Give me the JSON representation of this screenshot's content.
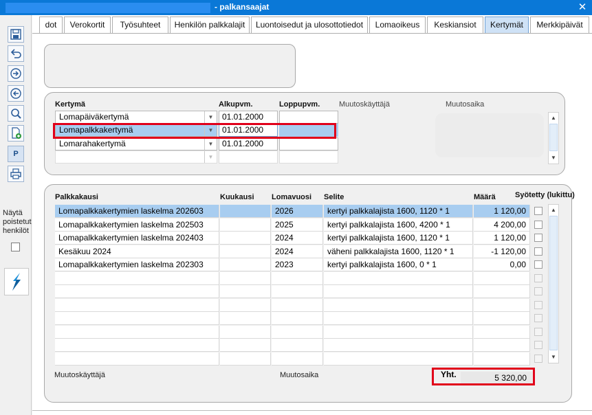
{
  "window": {
    "title": "- palkansaajat",
    "close_glyph": "✕"
  },
  "tabs": [
    {
      "label": "dot"
    },
    {
      "label": "Verokortit"
    },
    {
      "label": "Työsuhteet"
    },
    {
      "label": "Henkilön palkkalajit"
    },
    {
      "label": "Luontoisedut ja ulosottotiedot"
    },
    {
      "label": "Lomaoikeus"
    },
    {
      "label": "Keskiansiot"
    },
    {
      "label": "Kertymät"
    },
    {
      "label": "Merkkipäivät"
    }
  ],
  "sidebar": {
    "p_label": "P",
    "show_deleted_label": "Näytä poistetut henkilöt"
  },
  "accruals": {
    "headers": {
      "type": "Kertymä",
      "start": "Alkupvm.",
      "end": "Loppupvm.",
      "modified_by": "Muutoskäyttäjä",
      "modified_at": "Muutosaika"
    },
    "rows": [
      {
        "type": "Lomapäiväkertymä",
        "start": "01.01.2000",
        "end": ""
      },
      {
        "type": "Lomapalkkakertymä",
        "start": "01.01.2000",
        "end": ""
      },
      {
        "type": "Lomarahakertymä",
        "start": "01.01.2000",
        "end": ""
      }
    ]
  },
  "periods": {
    "headers": {
      "period": "Palkkakausi",
      "month": "Kuukausi",
      "holiday_year": "Lomavuosi",
      "description": "Selite",
      "amount": "Määrä",
      "entered": "Syötetty (lukittu)"
    },
    "rows": [
      {
        "period": "Lomapalkkakertymien laskelma 202603",
        "month": "",
        "year": "2026",
        "desc": "kertyi palkkalajista 1600, 1120 * 1",
        "amount": "1 120,00"
      },
      {
        "period": "Lomapalkkakertymien laskelma 202503",
        "month": "",
        "year": "2025",
        "desc": "kertyi palkkalajista 1600, 4200 * 1",
        "amount": "4 200,00"
      },
      {
        "period": "Lomapalkkakertymien laskelma 202403",
        "month": "",
        "year": "2024",
        "desc": "kertyi palkkalajista 1600, 1120 * 1",
        "amount": "1 120,00"
      },
      {
        "period": "Kesäkuu 2024",
        "month": "",
        "year": "2024",
        "desc": "väheni palkkalajista 1600, 1120 * 1",
        "amount": "-1 120,00"
      },
      {
        "period": "Lomapalkkakertymien laskelma 202303",
        "month": "",
        "year": "2023",
        "desc": "kertyi palkkalajista 1600, 0 * 1",
        "amount": "0,00"
      }
    ],
    "footer": {
      "modified_by": "Muutoskäyttäjä",
      "modified_at": "Muutosaika",
      "total_label": "Yht.",
      "total_value": "5 320,00"
    }
  }
}
